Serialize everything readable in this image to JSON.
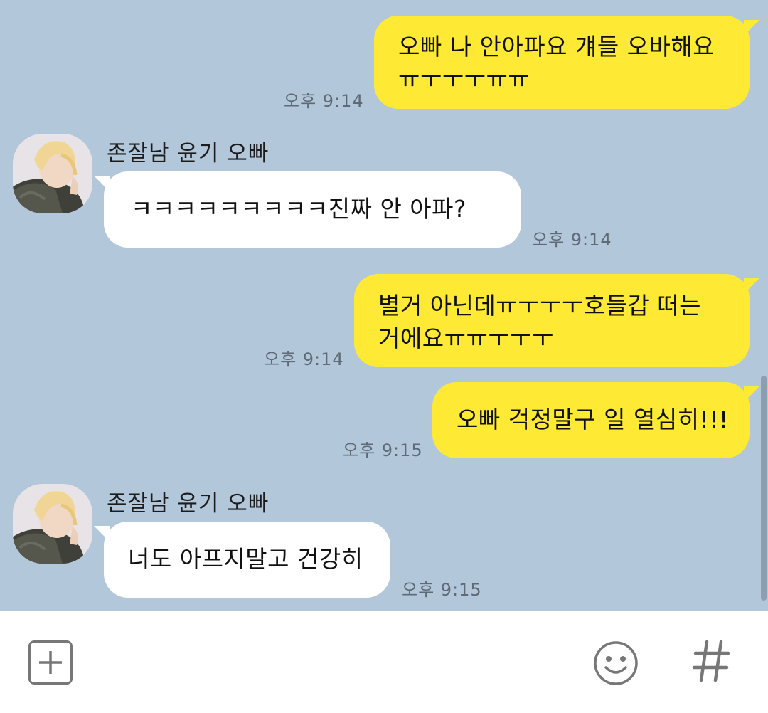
{
  "messages": [
    {
      "side": "me",
      "text": "오빠 나 안아파요 걔들 오바해요\nㅠㅜㅜㅜㅠㅠ",
      "time": "오후 9:14"
    },
    {
      "side": "other",
      "sender": "존잘남 윤기 오빠",
      "text": "ㅋㅋㅋㅋㅋㅋㅋㅋㅋ진짜 안 아파?",
      "time": "오후 9:14"
    },
    {
      "side": "me",
      "text": "별거 아닌데ㅠㅜㅜㅜ호들갑 떠는\n거에요ㅠㅠㅜㅜㅜ",
      "time": "오후 9:14"
    },
    {
      "side": "me",
      "text": "오빠 걱정말구 일 열심히!!!",
      "time": "오후 9:15"
    },
    {
      "side": "other",
      "sender": "존잘남 윤기 오빠",
      "text": "너도 아프지말고 건강히",
      "time": "오후 9:15"
    }
  ],
  "input_bar": {
    "plus_icon": "plus-icon",
    "emoji_icon": "smiley-icon",
    "hash_icon": "hash-icon",
    "hash_glyph": "#"
  },
  "colors": {
    "background": "#b2c7da",
    "my_bubble": "#fee934",
    "other_bubble": "#ffffff"
  }
}
